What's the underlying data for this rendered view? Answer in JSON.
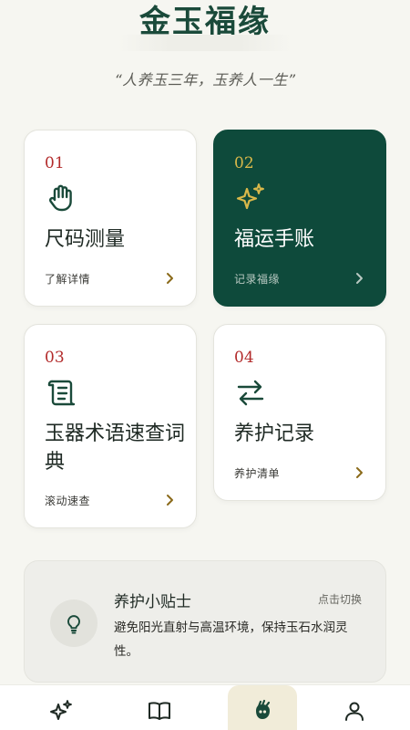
{
  "header": {
    "app_title": "金玉福缘",
    "motto": "“人养玉三年，玉养人一生”"
  },
  "cards": [
    {
      "num": "01",
      "title": "尺码测量",
      "sub": "了解详情",
      "icon": "hand-icon"
    },
    {
      "num": "02",
      "title": "福运手账",
      "sub": "记录福缘",
      "icon": "sparkles-icon"
    },
    {
      "num": "03",
      "title": "玉器术语速查词典",
      "sub": "滚动速查",
      "icon": "scroll-icon"
    },
    {
      "num": "04",
      "title": "养护记录",
      "sub": "养护清单",
      "icon": "arrows-swap-icon"
    }
  ],
  "tip": {
    "title": "养护小贴士",
    "switch_label": "点击切换",
    "text": "避免阳光直射与高温环境，保持玉石水润灵性。",
    "icon": "lightbulb-icon"
  },
  "tabbar": {
    "tabs": [
      {
        "label": "",
        "icon": "sparkles-icon"
      },
      {
        "label": "",
        "icon": "book-icon"
      },
      {
        "label": "",
        "icon": "hand-bracelet-icon",
        "active": true
      },
      {
        "label": "",
        "icon": "user-icon"
      }
    ]
  },
  "colors": {
    "brand_green": "#0e4a3b",
    "accent_red": "#b22a2a",
    "accent_gold": "#d9b84a",
    "background": "#f6f6f1"
  }
}
